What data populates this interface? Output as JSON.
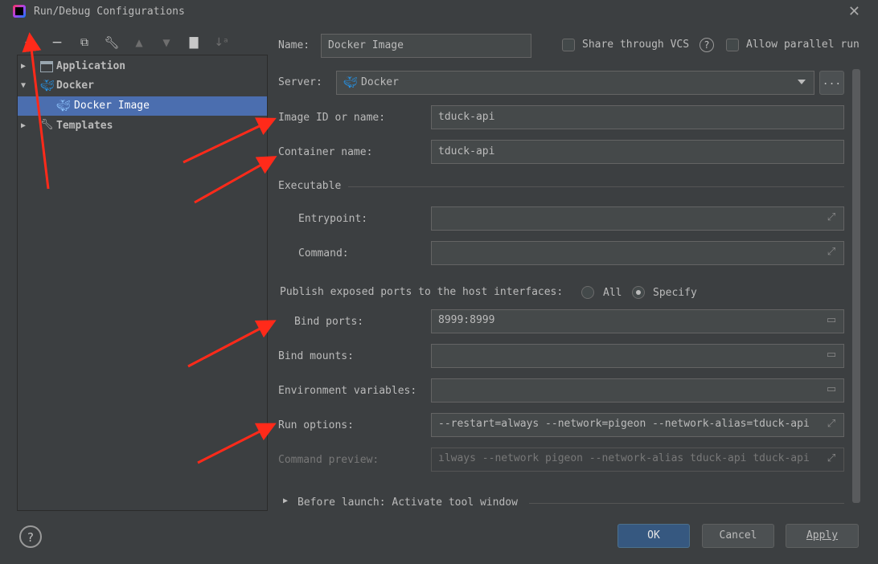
{
  "window": {
    "title": "Run/Debug Configurations"
  },
  "toolbar": {
    "icons": [
      "add-icon",
      "remove-icon",
      "copy-icon",
      "wrench-icon",
      "move-up-icon",
      "move-down-icon",
      "new-folder-icon",
      "sort-icon"
    ]
  },
  "tree": {
    "items": [
      {
        "label": "Application",
        "icon": "application-icon"
      },
      {
        "label": "Docker",
        "icon": "docker-icon"
      },
      {
        "label": "Docker Image",
        "icon": "docker-image-icon"
      },
      {
        "label": "Templates",
        "icon": "wrench-icon"
      }
    ]
  },
  "form": {
    "name_label": "Name:",
    "name_value": "Docker Image",
    "share_label": "Share through VCS",
    "allow_parallel_label": "Allow parallel run",
    "server_label": "Server:",
    "server_value": "Docker",
    "server_more": "...",
    "image_label": "Image ID or name:",
    "image_value": "tduck-api",
    "container_label": "Container name:",
    "container_value": "tduck-api",
    "executable_label": "Executable",
    "entrypoint_label": "Entrypoint:",
    "entrypoint_value": "",
    "command_label": "Command:",
    "command_value": "",
    "publish_label": "Publish exposed ports to the host interfaces:",
    "publish_all": "All",
    "publish_specify": "Specify",
    "bind_ports_label": "Bind ports:",
    "bind_ports_value": "8999:8999",
    "bind_mounts_label": "Bind mounts:",
    "bind_mounts_value": "",
    "env_label": "Environment variables:",
    "env_value": "",
    "run_options_label": "Run options:",
    "run_options_value": "--restart=always --network=pigeon --network-alias=tduck-api",
    "preview_label": "Command preview:",
    "preview_value": "ılways --network pigeon --network-alias tduck-api tduck-api",
    "before_launch": "Before launch: Activate tool window"
  },
  "buttons": {
    "ok": "OK",
    "cancel": "Cancel",
    "apply": "Apply",
    "help": "?"
  },
  "colors": {
    "selection": "#4b6eaf",
    "primary_button": "#365880",
    "annotation_arrow": "#ff2a1a",
    "docker_blue": "#2496ed"
  }
}
